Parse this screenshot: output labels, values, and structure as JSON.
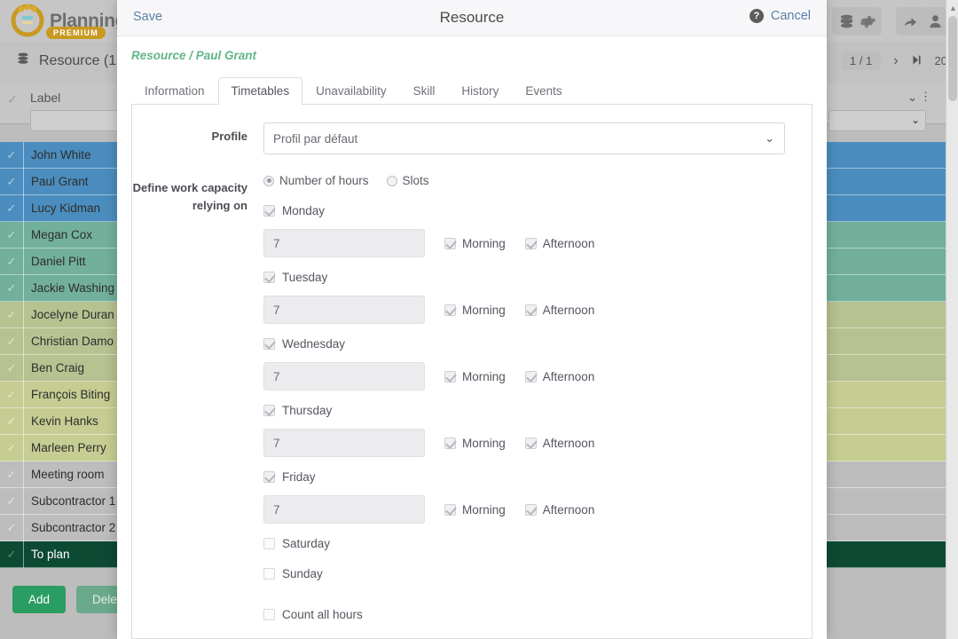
{
  "app": {
    "logo_text": "Planning",
    "logo_badge": "PREMIUM",
    "resource_title": "Resource (1",
    "db_icon": "database-icon",
    "gear_icon": "gear-icon",
    "share_icon": "share-icon",
    "user_icon": "user-icon"
  },
  "pager": {
    "page_indicator": "1 / 1",
    "next_icon": "›",
    "last_icon": "⏭",
    "page_size": "20"
  },
  "table": {
    "header_label": "Label",
    "caret_icon": "chevron-down-icon",
    "dots_icon": "more-vertical-icon",
    "filter_value": "",
    "rows": [
      {
        "label": "John White",
        "color": "#4b8dbe",
        "checked": true
      },
      {
        "label": "Paul Grant",
        "color": "#4b8dbe",
        "checked": true
      },
      {
        "label": "Lucy Kidman",
        "color": "#4b8dbe",
        "checked": true
      },
      {
        "label": "Megan Cox",
        "color": "#72b09c",
        "checked": true
      },
      {
        "label": "Daniel Pitt",
        "color": "#72b09c",
        "checked": true
      },
      {
        "label": "Jackie Washing",
        "color": "#72b09c",
        "checked": true
      },
      {
        "label": "Jocelyne Duran",
        "color": "#b7c291",
        "checked": true
      },
      {
        "label": "Christian Damo",
        "color": "#b7c291",
        "checked": true
      },
      {
        "label": "Ben Craig",
        "color": "#b7c291",
        "checked": true
      },
      {
        "label": "François Biting",
        "color": "#c6cd92",
        "checked": true
      },
      {
        "label": "Kevin Hanks",
        "color": "#c6cd92",
        "checked": true
      },
      {
        "label": "Marleen Perry",
        "color": "#c6cd92",
        "checked": true
      },
      {
        "label": "Meeting room",
        "color": "#bdbdbd",
        "checked": true
      },
      {
        "label": "Subcontractor 1",
        "color": "#bdbdbd",
        "checked": true
      },
      {
        "label": "Subcontractor 2",
        "color": "#bdbdbd",
        "checked": true
      },
      {
        "label": "To plan",
        "color": "#0d4a34",
        "checked": true,
        "dark": true
      }
    ]
  },
  "actions": {
    "add_label": "Add",
    "delete_label": "Delete"
  },
  "modal": {
    "save_label": "Save",
    "title": "Resource",
    "help_icon": "?",
    "cancel_label": "Cancel",
    "breadcrumb": "Resource / Paul Grant",
    "tabs": [
      {
        "label": "Information",
        "active": false
      },
      {
        "label": "Timetables",
        "active": true
      },
      {
        "label": "Unavailability",
        "active": false
      },
      {
        "label": "Skill",
        "active": false
      },
      {
        "label": "History",
        "active": false
      },
      {
        "label": "Events",
        "active": false
      }
    ],
    "form": {
      "profile_label": "Profile",
      "profile_value": "Profil par défaut",
      "capacity_label": "Define work capacity relying on",
      "mode_options": [
        {
          "label": "Number of hours",
          "selected": true
        },
        {
          "label": "Slots",
          "selected": false
        }
      ],
      "morning_label": "Morning",
      "afternoon_label": "Afternoon",
      "days": [
        {
          "label": "Monday",
          "checked": true,
          "hours": "7",
          "morning": true,
          "afternoon": true,
          "has_hours": true
        },
        {
          "label": "Tuesday",
          "checked": true,
          "hours": "7",
          "morning": true,
          "afternoon": true,
          "has_hours": true
        },
        {
          "label": "Wednesday",
          "checked": true,
          "hours": "7",
          "morning": true,
          "afternoon": true,
          "has_hours": true
        },
        {
          "label": "Thursday",
          "checked": true,
          "hours": "7",
          "morning": true,
          "afternoon": true,
          "has_hours": true
        },
        {
          "label": "Friday",
          "checked": true,
          "hours": "7",
          "morning": true,
          "afternoon": true,
          "has_hours": true
        },
        {
          "label": "Saturday",
          "checked": false,
          "hours": "",
          "morning": false,
          "afternoon": false,
          "has_hours": false
        },
        {
          "label": "Sunday",
          "checked": false,
          "hours": "",
          "morning": false,
          "afternoon": false,
          "has_hours": false
        }
      ],
      "count_all_hours_label": "Count all hours",
      "count_all_hours_checked": false
    }
  }
}
